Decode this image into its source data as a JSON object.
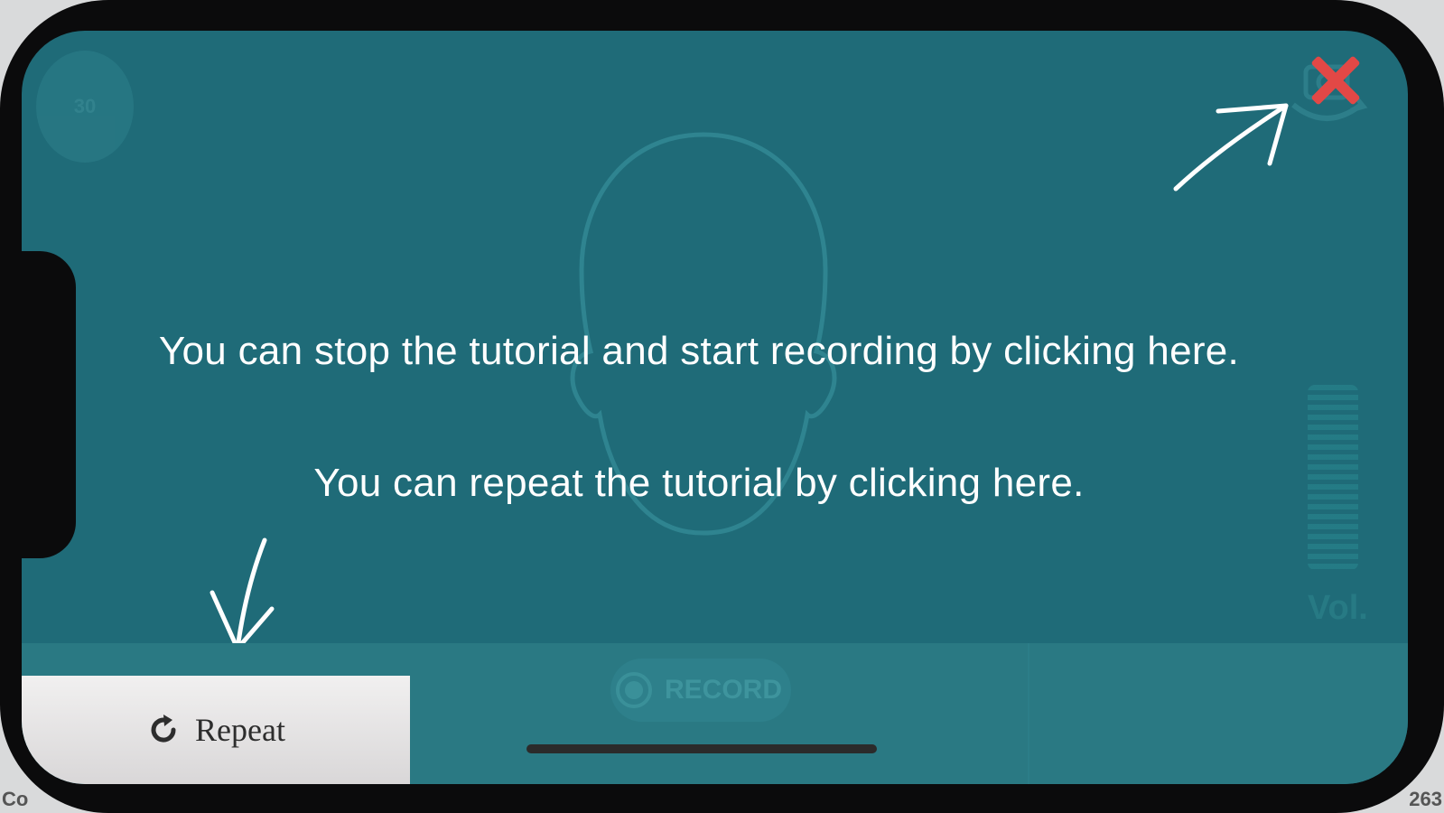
{
  "tutorial": {
    "stop_message": "You can stop the tutorial and start recording by clicking here.",
    "repeat_message": "You can repeat the tutorial by clicking here."
  },
  "toolbar": {
    "repeat_label": "Repeat",
    "record_label": "RECORD"
  },
  "hud": {
    "timer_text": "30",
    "volume_label": "Vol."
  },
  "device_edge": {
    "left_text": "Co",
    "right_text": "263"
  },
  "icons": {
    "close": "close-icon",
    "repeat": "refresh-icon",
    "record": "record-icon",
    "camera_switch": "camera-switch-icon",
    "face_outline": "face-outline-icon"
  },
  "colors": {
    "screen_background": "#1f6b78",
    "close_red": "#e24846",
    "repeat_button_bg": "#ecebeb"
  }
}
